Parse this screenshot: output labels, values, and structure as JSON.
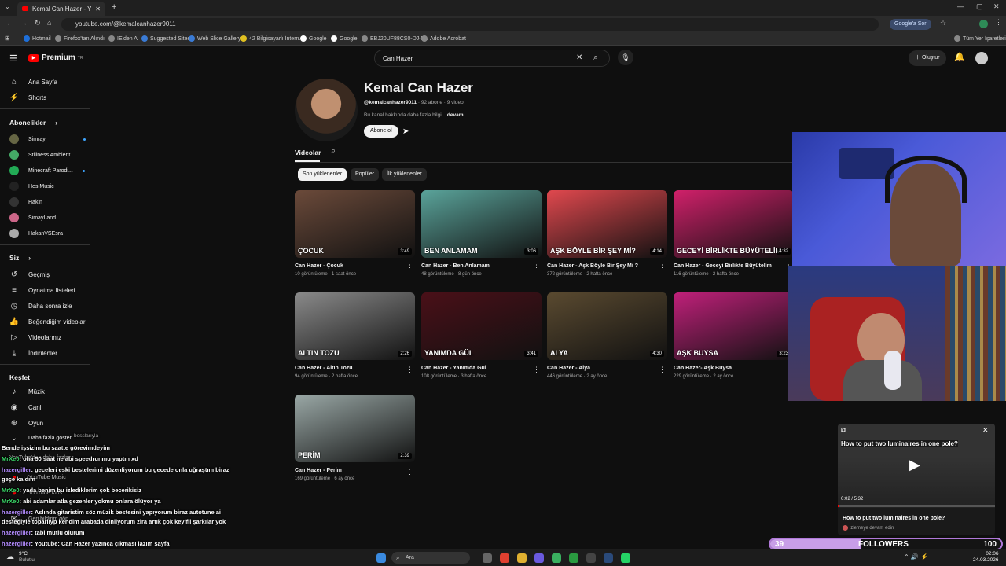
{
  "browser": {
    "tab_title": "Kemal Can Hazer - YouTube",
    "url": "youtube.com/@kemalcanhazer9011",
    "ask_google": "Google'a Sor",
    "all_bookmarks": "Tüm Yer İşaretleri",
    "bookmarks": [
      "Hotmail",
      "Firefox'tan Alındı",
      "IE'den Al",
      "Suggested Sites",
      "Web Slice Gallery",
      "42 Bilgisayarlı İntern...",
      "Google",
      "Google",
      "EBJ20UF88CS0-DJ-F...",
      "Adobe Acrobat"
    ]
  },
  "youtube": {
    "logo_text": "Premium",
    "logo_sup": "TR",
    "search_value": "Can Hazer",
    "create_label": "Oluştur",
    "sidebar": {
      "home": "Ana Sayfa",
      "shorts": "Shorts",
      "subscriptions_header": "Abonelikler",
      "subscriptions": [
        "Simray",
        "Stillness Ambient",
        "Minecraft Parodi...",
        "Hes Music",
        "Hakin",
        "SimayLand",
        "HakanVSEsra"
      ],
      "you_header": "Siz",
      "you_items": [
        "Geçmiş",
        "Oynatma listeleri",
        "Daha sonra izle",
        "Beğendiğim videolar",
        "Videolarınız",
        "İndirilenler"
      ],
      "explore_header": "Keşfet",
      "explore_items": [
        "Müzik",
        "Canlı",
        "Oyun"
      ],
      "show_more": "Daha fazla göster",
      "more_from": "YouTube'dan daha fazlası",
      "yt_music": "YouTube Music",
      "yt_kids": "YouTube Kids",
      "feedback": "Geri bildirim gön..."
    },
    "channel": {
      "name": "Kemal Can Hazer",
      "handle": "@kemalcanhazer9011",
      "stats": "· 92 abone · 9 video",
      "about": "Bu kanal hakkında daha fazla bilgi",
      "more": "...devamı",
      "subscribe": "Abone ol",
      "tab_videos": "Videolar"
    },
    "chips": [
      "Son yüklenenler",
      "Popüler",
      "İlk yüklenenler"
    ],
    "videos": [
      {
        "title": "Can Hazer - Çocuk",
        "meta": "10 görüntüleme · 1 saat önce",
        "duration": "3:49",
        "thumb_label": "ÇOCUK",
        "bg": "#6b4a3a"
      },
      {
        "title": "Can Hazer - Ben Anlamam",
        "meta": "48 görüntüleme · 8 gün önce",
        "duration": "3:06",
        "thumb_label": "BEN ANLAMAM",
        "bg": "#5aa39a"
      },
      {
        "title": "Can Hazer - Aşk Böyle Bir Şey Mi ?",
        "meta": "372 görüntüleme · 2 hafta önce",
        "duration": "4:14",
        "thumb_label": "AŞK BÖYLE BİR ŞEY Mİ?",
        "bg": "#e0484e"
      },
      {
        "title": "Can Hazer - Geceyi Birlikte Büyütelim",
        "meta": "116 görüntüleme · 2 hafta önce",
        "duration": "4:32",
        "thumb_label": "GECEYİ BİRLİKTE BÜYÜTELİM",
        "bg": "#d0206a"
      },
      {
        "title": "Can Hazer - Altın Tozu",
        "meta": "94 görüntüleme · 2 hafta önce",
        "duration": "2:26",
        "thumb_label": "ALTIN TOZU",
        "bg": "#8a8a8a"
      },
      {
        "title": "Can Hazer - Yanımda Gül",
        "meta": "108 görüntüleme · 3 hafta önce",
        "duration": "3:41",
        "thumb_label": "YANIMDA GÜL",
        "bg": "#4a1018"
      },
      {
        "title": "Can Hazer - Alya",
        "meta": "446 görüntüleme · 2 ay önce",
        "duration": "4:30",
        "thumb_label": "ALYA",
        "bg": "#5a4a30"
      },
      {
        "title": "Can Hazer- Aşk Buysa",
        "meta": "229 görüntüleme · 2 ay önce",
        "duration": "3:23",
        "thumb_label": "AŞK BUYSA",
        "bg": "#c0207a"
      },
      {
        "title": "Can Hazer - Perim",
        "meta": "169 görüntüleme · 6 ay önce",
        "duration": "2:39",
        "thumb_label": "PERİM",
        "bg": "#9aa8a6"
      }
    ]
  },
  "chat": [
    {
      "user": "",
      "msg": "Bende işsizim bu saatte görevimdeyim",
      "color": "#ff4040"
    },
    {
      "user": "MrXe0",
      "msg": ": oha 50 saat ne abi speedrunmu yaptın xd",
      "color": "#3bdc6a"
    },
    {
      "user": "hazergiller",
      "msg": ": geceleri eski bestelerimi düzenliyorum bu gecede onla uğraştım biraz",
      "color": "#b48cff"
    },
    {
      "user": "",
      "msg": "geçe kaldım",
      "color": "#b48cff"
    },
    {
      "user": "MrXe0",
      "msg": ": yada benim bu izlediklerim çok becerikisiz",
      "color": "#3bdc6a"
    },
    {
      "user": "MrXe0",
      "msg": ": abi adamlar atla gezenler yokmu onlara ölüyor ya",
      "color": "#3bdc6a"
    },
    {
      "user": "hazergiller",
      "msg": ": Aslında gitaristim söz müzik bestesini yapıyorum biraz autotune ai",
      "color": "#b48cff"
    },
    {
      "user": "",
      "msg": "desteğiyle toparlıyp kendim arabada dinliyorum zira artık çok keyifli şarkılar yok",
      "color": "#b48cff"
    },
    {
      "user": "hazergiller",
      "msg": ": tabi mutlu olurum",
      "color": "#b48cff"
    },
    {
      "user": "hazergiller",
      "msg": ": Youtube: Can Hazer yazınca çıkması lazım sayfa",
      "color": "#b48cff"
    }
  ],
  "chat_extra": "bosslarıyla",
  "popup": {
    "title": "How to put two luminaires in one pole?",
    "time": "0:02 / 5:32",
    "caption": "How to put two luminaires in one pole?",
    "sub": "İzlemeye devam edin"
  },
  "followers": {
    "current": "39",
    "label": "FOLLOWERS",
    "goal": "100",
    "progress": 0.39
  },
  "taskbar": {
    "weather_temp": "9°C",
    "weather_desc": "Bulutlu",
    "search": "Ara",
    "time": "02:06",
    "date": "24.03.2026"
  }
}
